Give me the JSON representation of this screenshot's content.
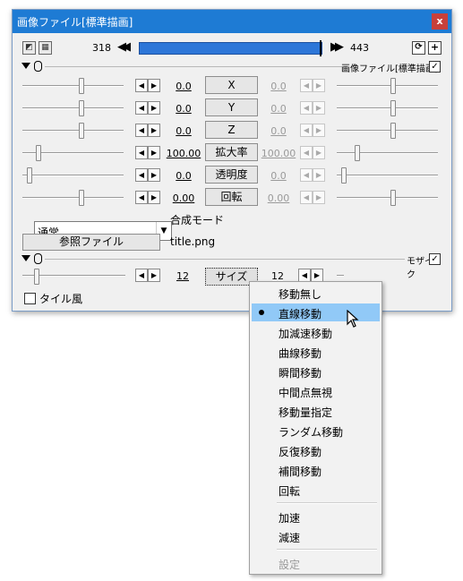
{
  "window": {
    "title": "画像ファイル[標準描画]",
    "close_label": "x"
  },
  "timeline": {
    "start": "318",
    "end": "443",
    "prev_label": "◀◀",
    "next_label": "▶▶",
    "add_label": "+"
  },
  "section1": {
    "label": "画像ファイル[標準描画]",
    "checked": true
  },
  "params": [
    {
      "left": "0.0",
      "label": "X",
      "right": "0.0"
    },
    {
      "left": "0.0",
      "label": "Y",
      "right": "0.0"
    },
    {
      "left": "0.0",
      "label": "Z",
      "right": "0.0"
    },
    {
      "left": "100.00",
      "label": "拡大率",
      "right": "100.00"
    },
    {
      "left": "0.0",
      "label": "透明度",
      "right": "0.0"
    },
    {
      "left": "0.00",
      "label": "回転",
      "right": "0.00"
    }
  ],
  "blend": {
    "value": "通常",
    "label": "合成モード"
  },
  "file": {
    "button_label": "参照ファイル",
    "filename": "title.png"
  },
  "section2": {
    "label": "モザイク",
    "checked": true,
    "size_left": "12",
    "size_label": "サイズ",
    "size_right": "12"
  },
  "tile_checkbox_label": "タイル風",
  "menu": {
    "items": [
      "移動無し",
      "直線移動",
      "加減速移動",
      "曲線移動",
      "瞬間移動",
      "中間点無視",
      "移動量指定",
      "ランダム移動",
      "反復移動",
      "補間移動",
      "回転"
    ],
    "extra": [
      "加速",
      "減速"
    ],
    "settings": "設定",
    "selected_index": 1
  }
}
